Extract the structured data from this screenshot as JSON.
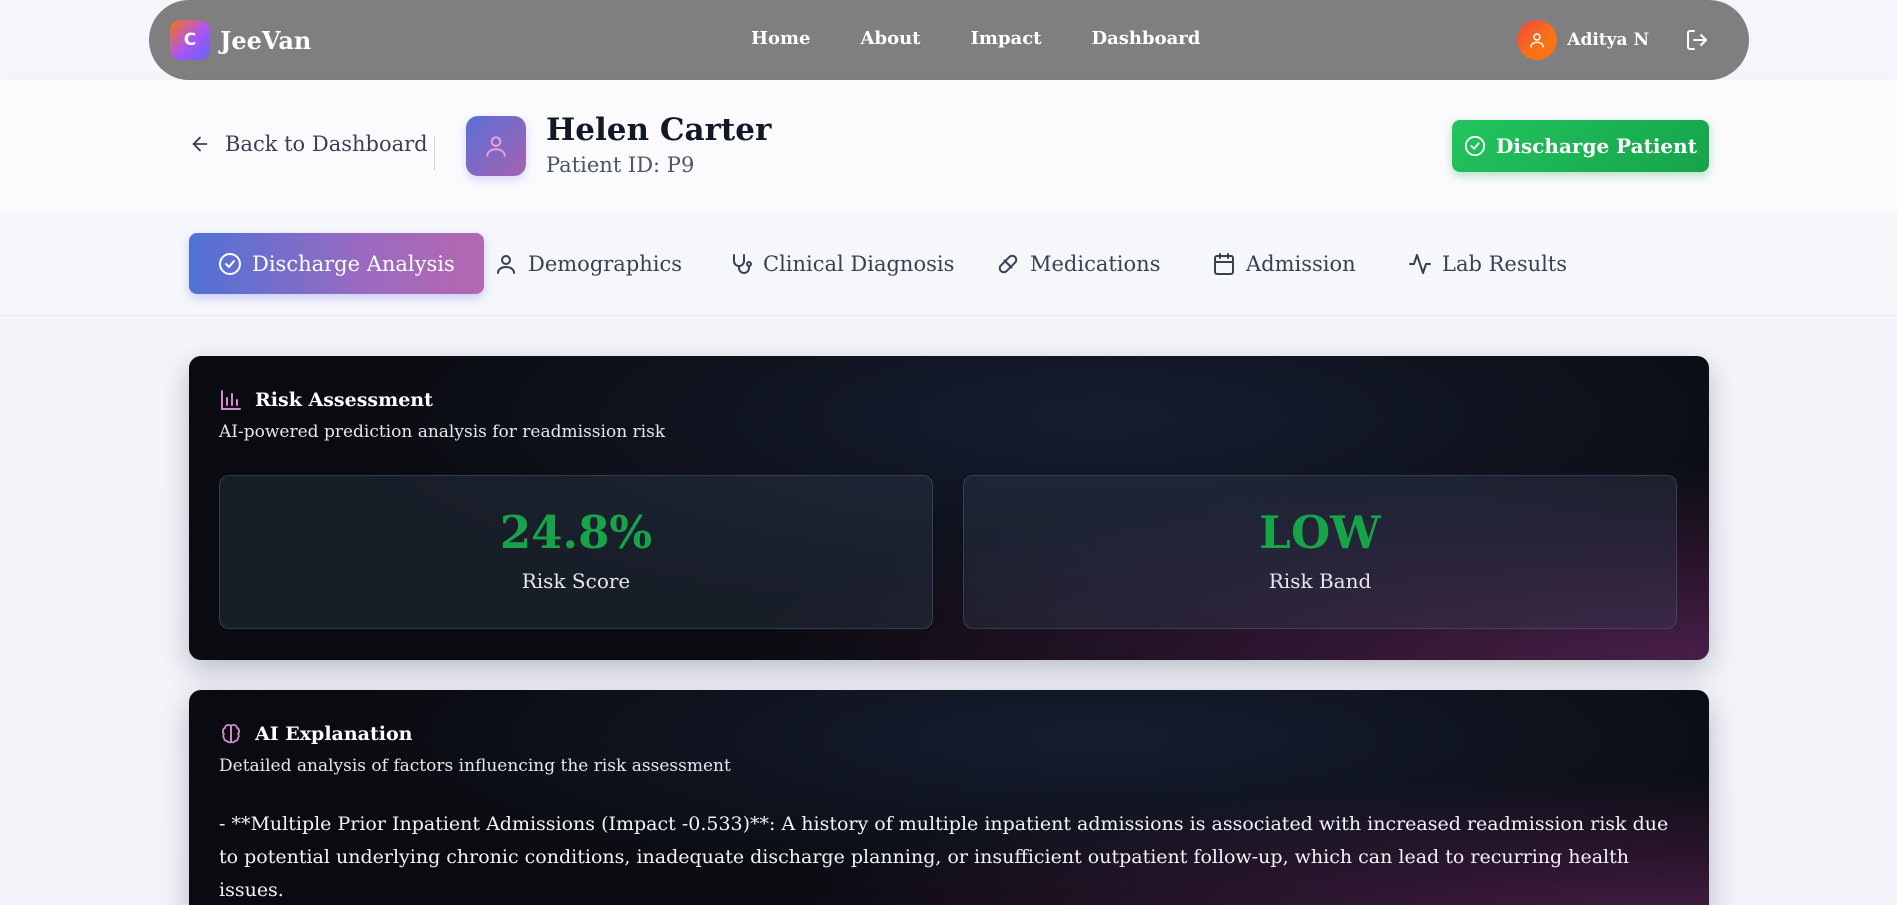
{
  "nav": {
    "logo_letter": "C",
    "brand": "JeeVan",
    "links": [
      "Home",
      "About",
      "Impact",
      "Dashboard"
    ],
    "user_name": "Aditya N"
  },
  "header": {
    "back_label": "Back to Dashboard",
    "patient_name": "Helen Carter",
    "patient_id": "Patient ID: P9",
    "discharge_label": "Discharge Patient"
  },
  "tabs": [
    {
      "label": "Discharge Analysis",
      "icon": "check-circle-icon",
      "active": true
    },
    {
      "label": "Demographics",
      "icon": "user-icon",
      "active": false
    },
    {
      "label": "Clinical Diagnosis",
      "icon": "stethoscope-icon",
      "active": false
    },
    {
      "label": "Medications",
      "icon": "pill-icon",
      "active": false
    },
    {
      "label": "Admission",
      "icon": "calendar-icon",
      "active": false
    },
    {
      "label": "Lab Results",
      "icon": "activity-icon",
      "active": false
    }
  ],
  "risk": {
    "title": "Risk Assessment",
    "subtitle": "AI-powered prediction analysis for readmission risk",
    "score_value": "24.8%",
    "score_label": "Risk Score",
    "band_value": "LOW",
    "band_label": "Risk Band"
  },
  "explanation": {
    "title": "AI Explanation",
    "subtitle": "Detailed analysis of factors influencing the risk assessment",
    "text": "- **Multiple Prior Inpatient Admissions (Impact -0.533)**: A history of multiple inpatient admissions is associated with increased readmission risk due to potential underlying chronic conditions, inadequate discharge planning, or insufficient outpatient follow-up, which can lead to recurring health issues."
  },
  "colors": {
    "accent_green": "#16a34a",
    "tab_gradient_start": "#4f72d6",
    "tab_gradient_end": "#b468b0",
    "nav_bg": "#7f7f7f"
  }
}
